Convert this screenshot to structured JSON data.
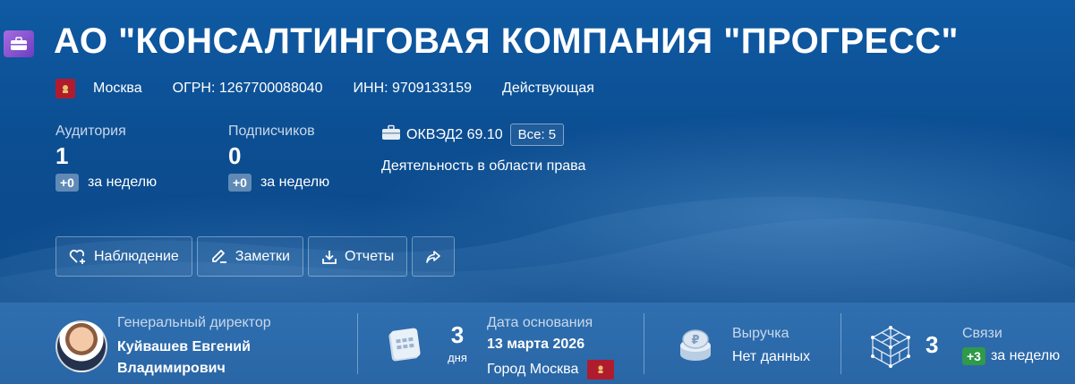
{
  "company": {
    "name": "АО \"КОНСАЛТИНГОВАЯ КОМПАНИЯ \"ПРОГРЕСС\"",
    "region": "Москва",
    "ogrn": "ОГРН: 1267700088040",
    "inn": "ИНН: 9709133159",
    "status": "Действующая"
  },
  "stats": {
    "audience": {
      "label": "Аудитория",
      "value": "1",
      "delta": "+0",
      "period": "за неделю"
    },
    "subscribers": {
      "label": "Подписчиков",
      "value": "0",
      "delta": "+0",
      "period": "за неделю"
    }
  },
  "okved": {
    "code": "ОКВЭД2 69.10",
    "all_label": "Все: 5",
    "description": "Деятельность в области права"
  },
  "actions": {
    "watch": "Наблюдение",
    "notes": "Заметки",
    "reports": "Отчеты"
  },
  "summary": {
    "director": {
      "role": "Генеральный директор",
      "name_line1": "Куйвашев Евгений",
      "name_line2": "Владимирович"
    },
    "founded": {
      "count": "3",
      "unit": "дня",
      "label": "Дата основания",
      "date": "13 марта 2026",
      "city": "Город Москва"
    },
    "revenue": {
      "label": "Выручка",
      "value": "Нет данных"
    },
    "links": {
      "count": "3",
      "label": "Связи",
      "delta": "+3",
      "period": "за неделю"
    }
  },
  "icons": {
    "company": "briefcase-icon",
    "region": "moscow-flag-icon",
    "okved": "briefcase-icon",
    "watch": "heart-plus-icon",
    "notes": "pencil-icon",
    "reports": "download-icon",
    "share": "share-arrow-icon",
    "founded": "calendar-icon",
    "revenue": "coins-ruble-icon",
    "links": "network-cube-icon"
  },
  "colors": {
    "hero_bg": "#0c4e92",
    "bottom_bg": "#2a66a6",
    "accent_purple": "#8a55d6",
    "moscow_red": "#b01c2e",
    "positive_green": "#2e9a4a"
  }
}
